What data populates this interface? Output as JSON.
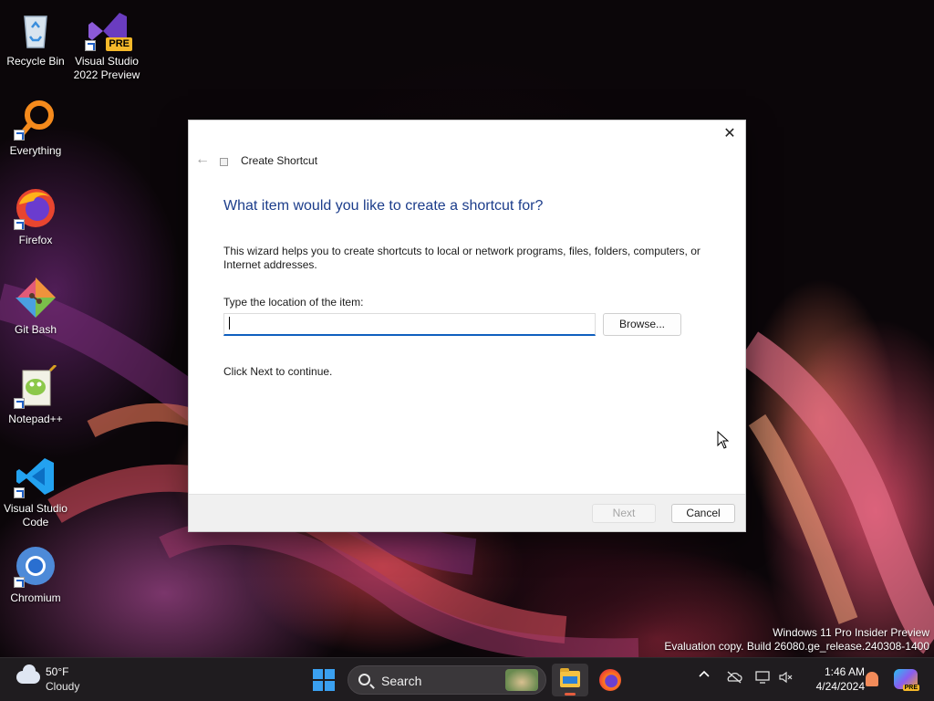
{
  "desktop": {
    "icons": [
      {
        "label": "Recycle Bin",
        "icon": "recycle-bin-icon"
      },
      {
        "label": "Visual Studio 2022 Preview",
        "icon": "visual-studio-icon",
        "badge": "PRE"
      },
      {
        "label": "Everything",
        "icon": "everything-search-icon"
      },
      {
        "label": "Firefox",
        "icon": "firefox-icon"
      },
      {
        "label": "Git Bash",
        "icon": "git-bash-icon"
      },
      {
        "label": "Notepad++",
        "icon": "notepad-plus-plus-icon"
      },
      {
        "label": "Visual Studio Code",
        "icon": "vscode-icon"
      },
      {
        "label": "Chromium",
        "icon": "chromium-icon"
      }
    ]
  },
  "dialog": {
    "title": "Create Shortcut",
    "heading": "What item would you like to create a shortcut for?",
    "description": "This wizard helps you to create shortcuts to local or network programs, files, folders, computers, or Internet addresses.",
    "location_label": "Type the location of the item:",
    "location_value": "",
    "browse_label": "Browse...",
    "hint": "Click Next to continue.",
    "next_label": "Next",
    "cancel_label": "Cancel",
    "close_glyph": "✕",
    "back_glyph": "←"
  },
  "watermark": {
    "line1": "Windows 11 Pro Insider Preview",
    "line2": "Evaluation copy. Build 26080.ge_release.240308-1400"
  },
  "taskbar": {
    "weather": {
      "temp": "50°F",
      "condition": "Cloudy"
    },
    "search_label": "Search",
    "pinned": [
      "File Explorer",
      "Firefox"
    ],
    "tray_chevron": "^",
    "clock": {
      "time": "1:46 AM",
      "date": "4/24/2024"
    },
    "copilot_badge": "PRE"
  },
  "colors": {
    "heading": "#1c3d8b",
    "input_focus": "#0f5fbf",
    "start_accent": "#3aa0f0"
  }
}
